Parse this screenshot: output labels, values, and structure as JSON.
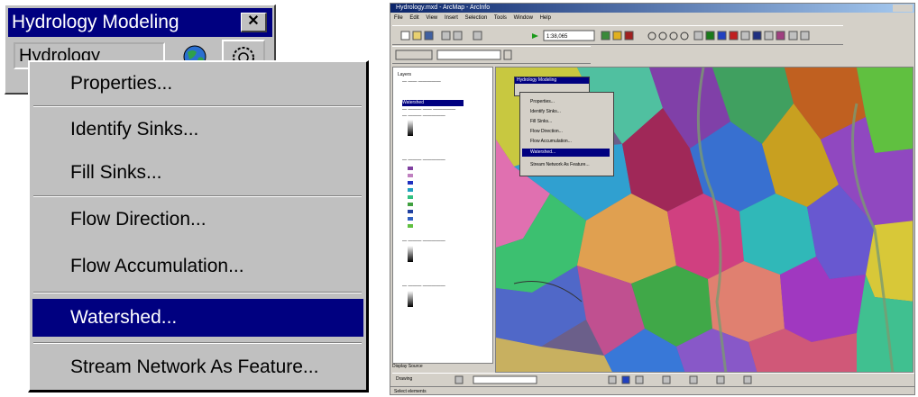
{
  "toolbar": {
    "title": "Hydrology Modeling",
    "close_label": "✕",
    "dropdown_value": "Hydrology"
  },
  "menu": {
    "items": [
      "Properties...",
      "Identify Sinks...",
      "Fill Sinks...",
      "Flow Direction...",
      "Flow Accumulation...",
      "Watershed...",
      "Stream Network As Feature..."
    ],
    "highlighted": "Watershed..."
  },
  "arcmap": {
    "title": "Hydrology.mxd - ArcMap - ArcInfo",
    "menubar": [
      "File",
      "Edit",
      "View",
      "Insert",
      "Selection",
      "Tools",
      "Window",
      "Help"
    ],
    "scale": "1:38,065",
    "toc": {
      "layers_label": "Layers",
      "selected_layer": "Watershed",
      "tabs": [
        "Display",
        "Source"
      ]
    },
    "mini_toolbar_title": "Hydrology Modeling",
    "mini_menu": [
      "Properties...",
      "Identify Sinks...",
      "Fill Sinks...",
      "Flow Direction...",
      "Flow Accumulation...",
      "Watershed...",
      "Stream Network As Feature..."
    ],
    "drawing_label": "Drawing",
    "status": "Select elements"
  },
  "colors": {
    "title_blue": "#000080",
    "menu_gray": "#c0c0c0"
  }
}
